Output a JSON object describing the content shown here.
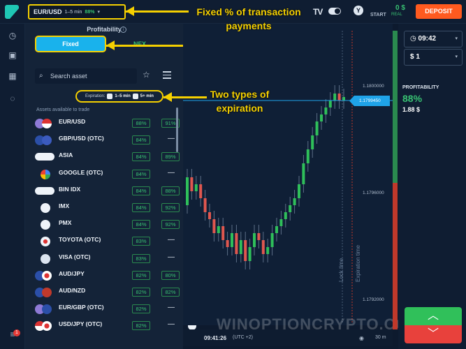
{
  "topbar": {
    "pair": "EUR/USD",
    "pair_time": "1–5 min",
    "pair_pct": "88%",
    "tv_logo": "TV",
    "start_label": "START",
    "balance": "0 $",
    "balance_type": "REAL",
    "deposit_label": "DEPOSIT"
  },
  "annotations": {
    "fixed": "Fixed % of transaction payments",
    "expiration": "Two types of expiration"
  },
  "panel": {
    "title": "Profitability",
    "fixed_label": "Fixed",
    "nfx_label": "NFX",
    "search_placeholder": "Search asset",
    "expiration_label": "Expiration:",
    "exp_opt1": "1–5 min",
    "exp_opt2": "5+ min",
    "assets_label": "Assets available to trade",
    "assets": [
      {
        "name": "EUR/USD",
        "p1": "88%",
        "p2": "91%"
      },
      {
        "name": "GBP/USD (OTC)",
        "p1": "84%",
        "p2": "—"
      },
      {
        "name": "ASIA",
        "p1": "84%",
        "p2": "89%"
      },
      {
        "name": "GOOGLE (OTC)",
        "p1": "84%",
        "p2": "—"
      },
      {
        "name": "BIN IDX",
        "p1": "84%",
        "p2": "88%"
      },
      {
        "name": "IMX",
        "p1": "84%",
        "p2": "92%"
      },
      {
        "name": "PMX",
        "p1": "84%",
        "p2": "92%"
      },
      {
        "name": "TOYOTA (OTC)",
        "p1": "83%",
        "p2": "—"
      },
      {
        "name": "VISA (OTC)",
        "p1": "83%",
        "p2": "—"
      },
      {
        "name": "AUD/JPY",
        "p1": "82%",
        "p2": "80%"
      },
      {
        "name": "AUD/NZD",
        "p1": "82%",
        "p2": "82%"
      },
      {
        "name": "EUR/GBP (OTC)",
        "p1": "82%",
        "p2": "—"
      },
      {
        "name": "USD/JPY (OTC)",
        "p1": "82%",
        "p2": "—"
      }
    ]
  },
  "chart": {
    "price_top": "1.1800000",
    "price_current": "1.1799450",
    "price_mid": "1.1796000",
    "price_low": "1.1792000",
    "lock_time": "Lock time",
    "expiration_time": "Expiration time",
    "time": "09:41:26",
    "timezone": "(UTC +2)",
    "timeframe": "30 m",
    "watermark": "WINOPTIONCRYPTO.COM"
  },
  "right_panel": {
    "time_value": "09:42",
    "amount_value": "1",
    "profitability_label": "PROFITABILITY",
    "profitability_pct": "88%",
    "payout": "1.88 $"
  },
  "colors": {
    "accent": "#19b2ec",
    "green": "#38c172",
    "red": "#e8413c",
    "annotation": "#f5d000",
    "deposit": "#ff5a1f"
  }
}
